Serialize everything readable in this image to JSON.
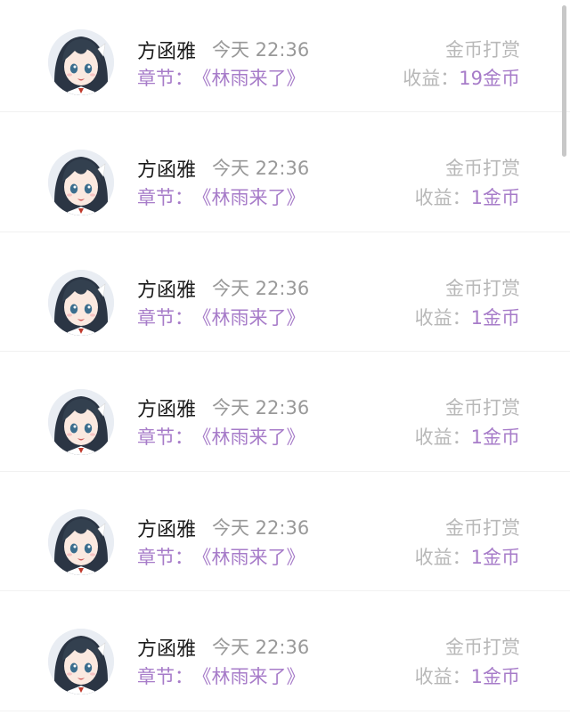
{
  "rows": [
    {
      "name": "方函雅",
      "time": "今天 22:36",
      "type": "金币打赏",
      "chapter_label": "章节：",
      "chapter": "《林雨来了》",
      "earn_label": "收益：",
      "earn_amount": "19金币"
    },
    {
      "name": "方函雅",
      "time": "今天 22:36",
      "type": "金币打赏",
      "chapter_label": "章节：",
      "chapter": "《林雨来了》",
      "earn_label": "收益：",
      "earn_amount": "1金币"
    },
    {
      "name": "方函雅",
      "time": "今天 22:36",
      "type": "金币打赏",
      "chapter_label": "章节：",
      "chapter": "《林雨来了》",
      "earn_label": "收益：",
      "earn_amount": "1金币"
    },
    {
      "name": "方函雅",
      "time": "今天 22:36",
      "type": "金币打赏",
      "chapter_label": "章节：",
      "chapter": "《林雨来了》",
      "earn_label": "收益：",
      "earn_amount": "1金币"
    },
    {
      "name": "方函雅",
      "time": "今天 22:36",
      "type": "金币打赏",
      "chapter_label": "章节：",
      "chapter": "《林雨来了》",
      "earn_label": "收益：",
      "earn_amount": "1金币"
    },
    {
      "name": "方函雅",
      "time": "今天 22:36",
      "type": "金币打赏",
      "chapter_label": "章节：",
      "chapter": "《林雨来了》",
      "earn_label": "收益：",
      "earn_amount": "1金币"
    }
  ],
  "colors": {
    "accent": "#a77cc9",
    "muted": "#b8b8b8",
    "name": "#1c1c1c"
  },
  "icons": {
    "avatar": "anime-girl-avatar"
  }
}
